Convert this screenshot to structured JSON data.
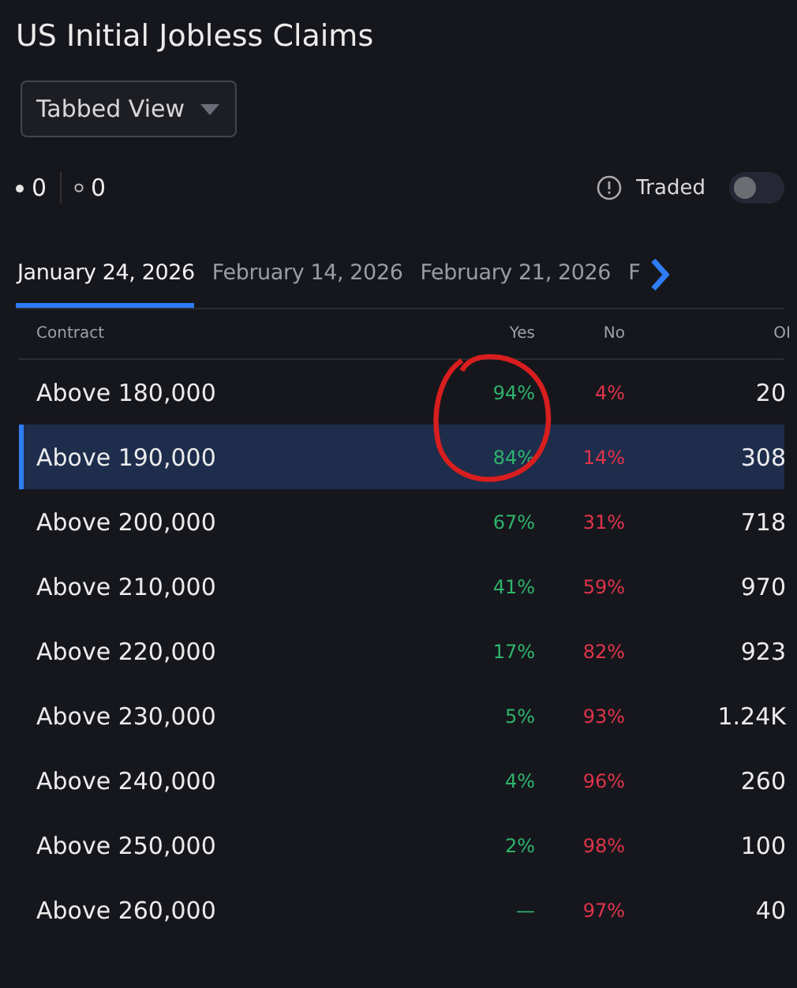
{
  "title": "US Initial Jobless Claims",
  "view_select": {
    "value": "Tabbed View"
  },
  "counts": [
    {
      "kind": "filled",
      "value": "0"
    },
    {
      "kind": "hollow",
      "value": "0"
    }
  ],
  "traded_toggle": {
    "label": "Traded",
    "on": false
  },
  "tabs": [
    {
      "label": "January 24, 2026",
      "selected": true
    },
    {
      "label": "February 14, 2026",
      "selected": false
    },
    {
      "label": "February 21, 2026",
      "selected": false
    },
    {
      "label": "F",
      "selected": false
    }
  ],
  "table": {
    "columns": [
      "Contract",
      "Yes",
      "No",
      "OI"
    ],
    "rows": [
      {
        "contract": "Above 180,000",
        "yes": "94%",
        "no": "4%",
        "oi": "20",
        "selected": false
      },
      {
        "contract": "Above 190,000",
        "yes": "84%",
        "no": "14%",
        "oi": "308",
        "selected": true
      },
      {
        "contract": "Above 200,000",
        "yes": "67%",
        "no": "31%",
        "oi": "718",
        "selected": false
      },
      {
        "contract": "Above 210,000",
        "yes": "41%",
        "no": "59%",
        "oi": "970",
        "selected": false
      },
      {
        "contract": "Above 220,000",
        "yes": "17%",
        "no": "82%",
        "oi": "923",
        "selected": false
      },
      {
        "contract": "Above 230,000",
        "yes": "5%",
        "no": "93%",
        "oi": "1.24K",
        "selected": false
      },
      {
        "contract": "Above 240,000",
        "yes": "4%",
        "no": "96%",
        "oi": "260",
        "selected": false
      },
      {
        "contract": "Above 250,000",
        "yes": "2%",
        "no": "98%",
        "oi": "100",
        "selected": false
      },
      {
        "contract": "Above 260,000",
        "yes": "—",
        "no": "97%",
        "oi": "40",
        "selected": false
      }
    ]
  }
}
